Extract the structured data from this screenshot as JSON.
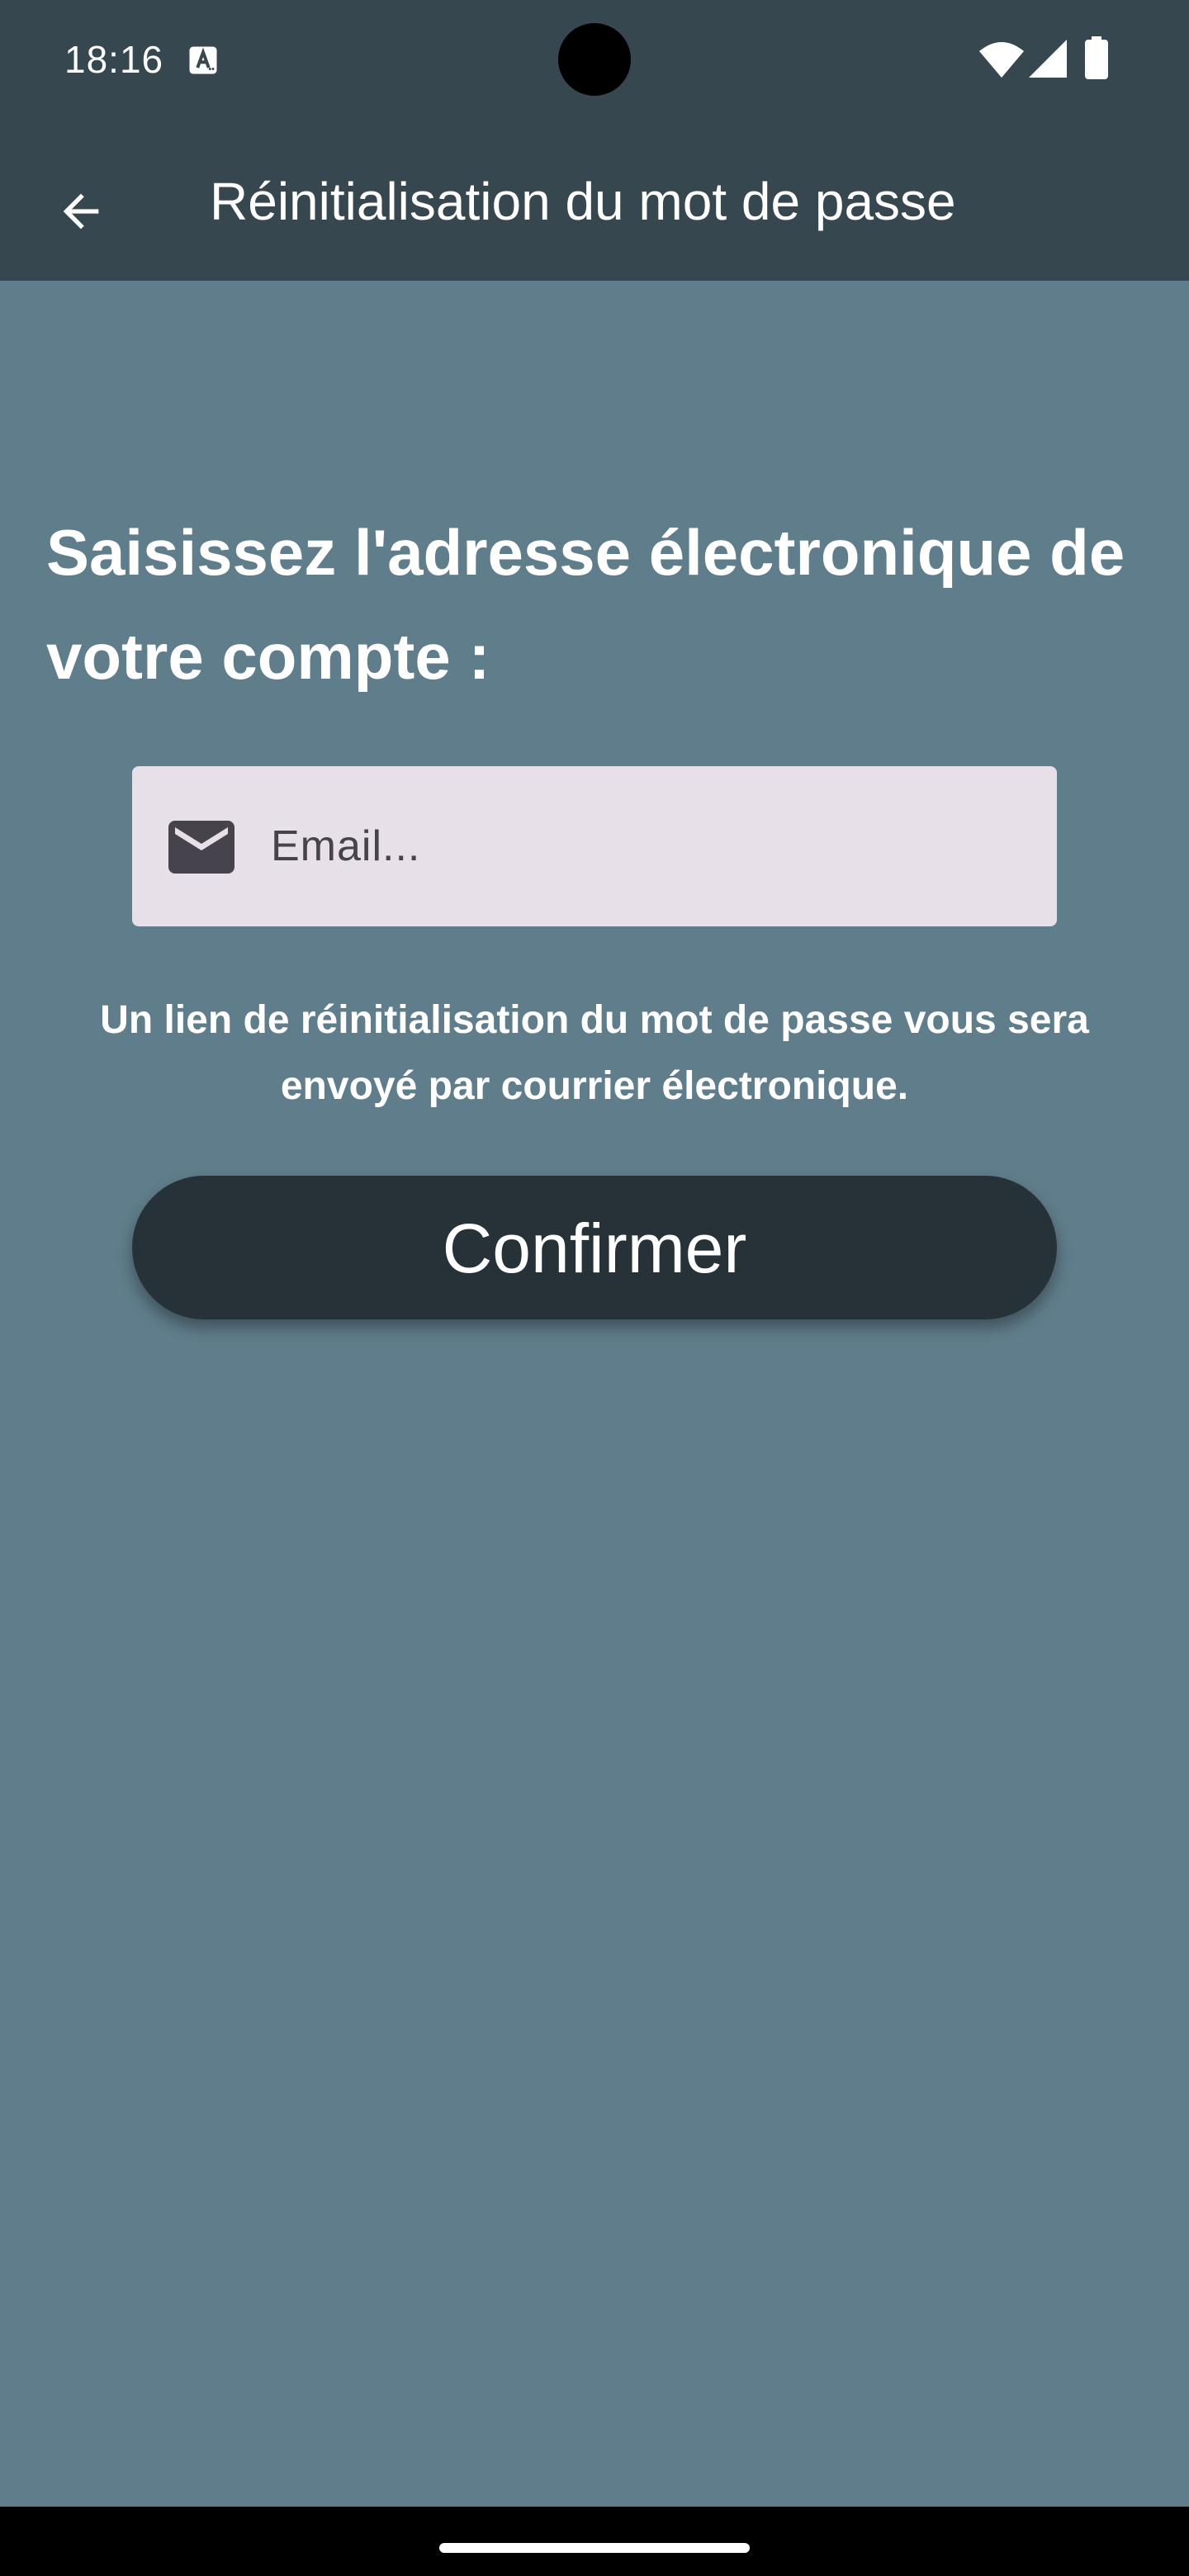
{
  "status_bar": {
    "time": "18:16",
    "icons": [
      "text-a-icon",
      "wifi-icon",
      "cell-signal-icon",
      "battery-icon"
    ]
  },
  "app_bar": {
    "back_icon": "arrow-back-icon",
    "title": "Réinitialisation du mot de passe"
  },
  "form": {
    "heading": "Saisissez l'adresse électronique de votre compte :",
    "email_icon": "mail-icon",
    "email_placeholder": "Email...",
    "email_value": "",
    "info": "Un lien de réinitialisation du mot de passe vous sera envoyé par courrier électronique.",
    "confirm_label": "Confirmer"
  },
  "colors": {
    "background": "#607d8b",
    "app_bar": "#37474f",
    "button": "#263238",
    "field": "#e7e0e8"
  }
}
